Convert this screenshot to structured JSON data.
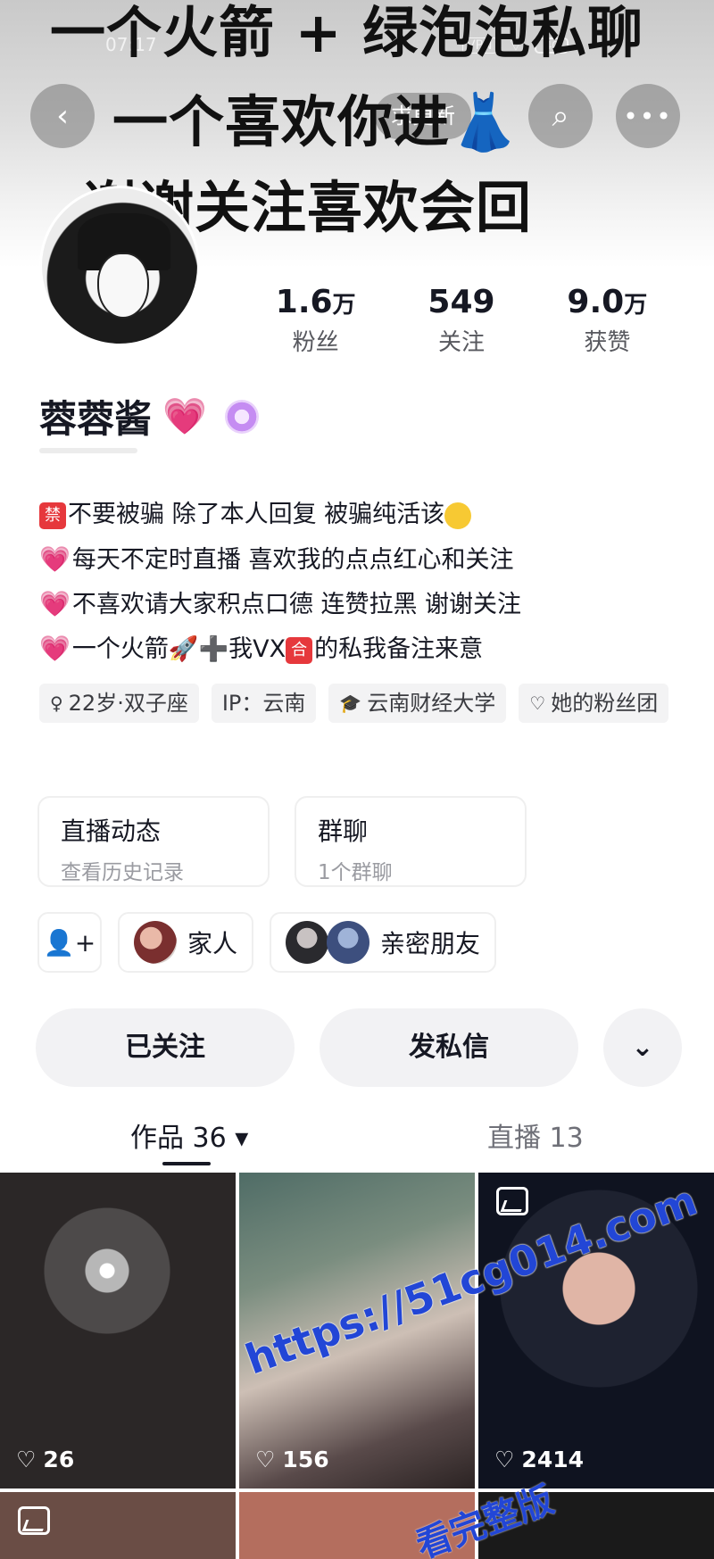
{
  "status_bar": {
    "time": "07:17",
    "net": "VPN",
    "battery": "40"
  },
  "overlay_text": [
    "一个火箭 + 绿泡泡私聊",
    "一个喜欢你进👗",
    "谢谢关注喜欢会回"
  ],
  "header": {
    "update_label": "求更新"
  },
  "profile": {
    "nickname": "蓉蓉酱",
    "stats": [
      {
        "value": "1.6",
        "unit": "万",
        "label": "粉丝"
      },
      {
        "value": "549",
        "unit": "",
        "label": "关注"
      },
      {
        "value": "9.0",
        "unit": "万",
        "label": "获赞"
      }
    ]
  },
  "bio": {
    "line1": "不要被骗 除了本人回复 被骗纯活该",
    "line1_box": "禁",
    "line2": "每天不定时直播  喜欢我的点点红心和关注",
    "line3": "不喜欢请大家积点口德 连赞拉黑 谢谢关注",
    "line4_a": "一个火箭🚀➕我VX",
    "line4_box": "合",
    "line4_b": "的私我备注来意"
  },
  "tags": {
    "age": "22岁·双子座",
    "ip": "IP：云南",
    "school": "云南财经大学",
    "fans_group": "她的粉丝团"
  },
  "cards": [
    {
      "title": "直播动态",
      "sub": "查看历史记录"
    },
    {
      "title": "群聊",
      "sub": "1个群聊"
    }
  ],
  "friends": {
    "family": "家人",
    "close_friends": "亲密朋友"
  },
  "actions": {
    "followed": "已关注",
    "message": "发私信"
  },
  "tabs": {
    "works": "作品 36 ▾",
    "live": "直播 13"
  },
  "grid": {
    "likes": [
      "26",
      "156",
      "2414"
    ]
  },
  "watermark": {
    "url": "https://51cg014.com",
    "caption": "看完整版"
  }
}
